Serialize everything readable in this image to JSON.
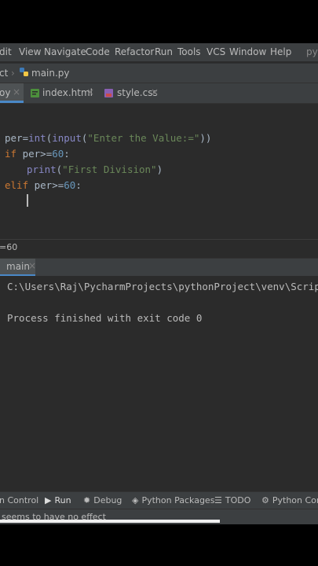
{
  "menu": [
    "dit",
    "View",
    "Navigate",
    "Code",
    "Refactor",
    "Run",
    "Tools",
    "VCS",
    "Window",
    "Help",
    "py"
  ],
  "nav": {
    "project": "ct",
    "file": "main.py"
  },
  "tabs": [
    {
      "label": "oy",
      "active": true
    },
    {
      "label": "index.html",
      "active": false
    },
    {
      "label": "style.css",
      "active": false
    }
  ],
  "code": {
    "l1": {
      "var": "per",
      "eq": "=",
      "f1": "int",
      "p1": "(",
      "f2": "input",
      "p2": "(",
      "str": "\"Enter the Value:=\"",
      "p3": "))"
    },
    "l2": {
      "kw": "if",
      "expr": " per>=",
      "num": "60",
      "colon": ":"
    },
    "l3": {
      "fn": "print",
      "p1": "(",
      "str": "\"First Division\"",
      "p2": ")"
    },
    "l4": {
      "kw": "elif",
      "expr": " per>=",
      "num": "60",
      "colon": ":"
    }
  },
  "breadcrumb": "=60",
  "run_tab": {
    "label": "main"
  },
  "console": {
    "path": "C:\\Users\\Raj\\PycharmProjects\\pythonProject\\venv\\Scripts\\",
    "exit": "Process finished with exit code 0"
  },
  "bottom_tools": [
    "n Control",
    "Run",
    "Debug",
    "Python Packages",
    "TODO",
    "Python Conso"
  ],
  "status": "seems to have no effect",
  "colors": {
    "keyword": "#cc7832",
    "builtin": "#8888c6",
    "string": "#6a8759",
    "number": "#6897bb",
    "accent": "#4a88c7"
  }
}
